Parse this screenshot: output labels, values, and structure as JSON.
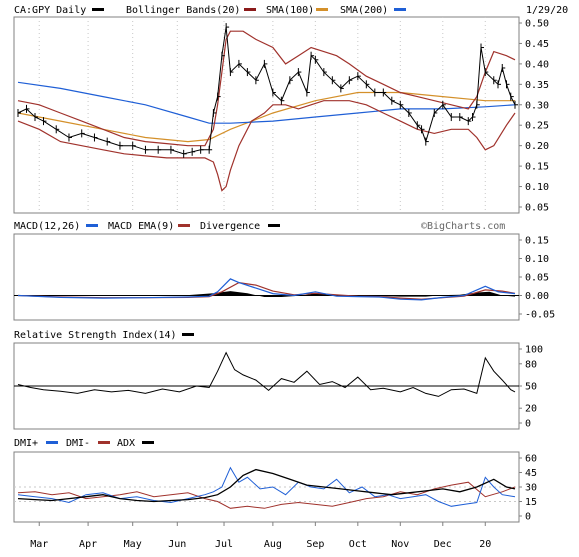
{
  "header": {
    "symbol_label": "CA:GPY Daily",
    "date": "1/29/20"
  },
  "legends": {
    "price": [
      {
        "label": "CA:GPY Daily",
        "color": "#000000"
      },
      {
        "label": "Bollinger Bands(20)",
        "color": "#000000"
      },
      {
        "label": "SMA(100)",
        "color": "#8b1a1a"
      },
      {
        "label": "SMA(200)",
        "color": "#d4902a"
      }
    ],
    "price_extra_swatch": "#1f5fd6",
    "macd": [
      {
        "label": "MACD(12,26)",
        "color": "#1f5fd6"
      },
      {
        "label": "MACD EMA(9)",
        "color": "#a0322c"
      },
      {
        "label": "Divergence",
        "color": "#000000"
      }
    ],
    "rsi": [
      {
        "label": "Relative Strength Index(14)",
        "color": "#000000"
      }
    ],
    "dmi": [
      {
        "label": "DMI+",
        "color": "#1f5fd6"
      },
      {
        "label": "DMI-",
        "color": "#a0322c"
      },
      {
        "label": "ADX",
        "color": "#000000"
      }
    ]
  },
  "watermark": "©BigCharts.com",
  "colors": {
    "price": "#000000",
    "bollinger": "#a0322c",
    "sma100": "#d4902a",
    "sma200": "#1f5fd6",
    "macd": "#1f5fd6",
    "macd_ema": "#a0322c",
    "divergence": "#000000",
    "rsi": "#000000",
    "dmi_plus": "#1f5fd6",
    "dmi_minus": "#a0322c",
    "adx": "#000000",
    "panel_border": "#808080",
    "grid": "#c8c8c8"
  },
  "chart_data": [
    {
      "type": "line",
      "panel": "price",
      "title": "CA:GPY Daily",
      "ylim": [
        0.05,
        0.5
      ],
      "y_ticks": [
        "0.50",
        "0.45",
        "0.40",
        "0.35",
        "0.30",
        "0.25",
        "0.20",
        "0.15",
        "0.10",
        "0.05"
      ],
      "y_tick_values": [
        0.5,
        0.45,
        0.4,
        0.35,
        0.3,
        0.25,
        0.2,
        0.15,
        0.1,
        0.05
      ],
      "x_labels": [
        "Mar",
        "Apr",
        "May",
        "Jun",
        "Jul",
        "Aug",
        "Sep",
        "Oct",
        "Nov",
        "Dec",
        "20"
      ],
      "x_label_t": [
        0.05,
        0.165,
        0.27,
        0.375,
        0.485,
        0.6,
        0.7,
        0.8,
        0.9,
        1.0,
        1.1
      ],
      "t_range": [
        0,
        1.17
      ],
      "series": [
        {
          "name": "CA:GPY Daily",
          "x": [
            0,
            0.02,
            0.04,
            0.06,
            0.09,
            0.12,
            0.15,
            0.18,
            0.21,
            0.24,
            0.27,
            0.3,
            0.33,
            0.36,
            0.39,
            0.41,
            0.43,
            0.45,
            0.46,
            0.47,
            0.48,
            0.49,
            0.5,
            0.52,
            0.54,
            0.56,
            0.58,
            0.6,
            0.62,
            0.64,
            0.66,
            0.68,
            0.69,
            0.7,
            0.72,
            0.74,
            0.76,
            0.78,
            0.8,
            0.82,
            0.84,
            0.86,
            0.88,
            0.9,
            0.92,
            0.94,
            0.95,
            0.96,
            0.98,
            1.0,
            1.02,
            1.04,
            1.06,
            1.07,
            1.08,
            1.09,
            1.1,
            1.12,
            1.13,
            1.14,
            1.15,
            1.16,
            1.17
          ],
          "y": [
            0.28,
            0.29,
            0.27,
            0.26,
            0.24,
            0.22,
            0.23,
            0.22,
            0.21,
            0.2,
            0.2,
            0.19,
            0.19,
            0.19,
            0.18,
            0.185,
            0.19,
            0.19,
            0.28,
            0.32,
            0.42,
            0.49,
            0.38,
            0.4,
            0.38,
            0.36,
            0.4,
            0.33,
            0.31,
            0.36,
            0.38,
            0.33,
            0.42,
            0.41,
            0.38,
            0.36,
            0.34,
            0.36,
            0.37,
            0.35,
            0.33,
            0.33,
            0.31,
            0.3,
            0.28,
            0.25,
            0.24,
            0.21,
            0.28,
            0.3,
            0.27,
            0.27,
            0.26,
            0.27,
            0.3,
            0.44,
            0.38,
            0.36,
            0.35,
            0.39,
            0.35,
            0.32,
            0.3
          ]
        },
        {
          "name": "Bollinger Bands(20) upper",
          "x": [
            0,
            0.05,
            0.1,
            0.15,
            0.2,
            0.25,
            0.3,
            0.35,
            0.4,
            0.44,
            0.46,
            0.47,
            0.48,
            0.49,
            0.5,
            0.53,
            0.56,
            0.6,
            0.63,
            0.66,
            0.69,
            0.72,
            0.75,
            0.78,
            0.82,
            0.86,
            0.9,
            0.94,
            0.98,
            1.02,
            1.06,
            1.08,
            1.1,
            1.12,
            1.15,
            1.17
          ],
          "y": [
            0.31,
            0.3,
            0.28,
            0.26,
            0.24,
            0.22,
            0.21,
            0.205,
            0.2,
            0.2,
            0.24,
            0.3,
            0.38,
            0.46,
            0.48,
            0.48,
            0.46,
            0.44,
            0.4,
            0.42,
            0.44,
            0.43,
            0.42,
            0.4,
            0.37,
            0.35,
            0.33,
            0.32,
            0.31,
            0.3,
            0.29,
            0.32,
            0.38,
            0.43,
            0.42,
            0.41
          ]
        },
        {
          "name": "Bollinger Bands(20) lower",
          "x": [
            0,
            0.05,
            0.1,
            0.15,
            0.2,
            0.25,
            0.3,
            0.35,
            0.4,
            0.44,
            0.46,
            0.47,
            0.48,
            0.49,
            0.5,
            0.52,
            0.55,
            0.58,
            0.6,
            0.63,
            0.66,
            0.69,
            0.72,
            0.75,
            0.78,
            0.82,
            0.86,
            0.9,
            0.94,
            0.98,
            1.02,
            1.06,
            1.08,
            1.1,
            1.12,
            1.15,
            1.17
          ],
          "y": [
            0.26,
            0.24,
            0.21,
            0.2,
            0.19,
            0.18,
            0.175,
            0.17,
            0.17,
            0.17,
            0.16,
            0.13,
            0.09,
            0.1,
            0.14,
            0.2,
            0.26,
            0.28,
            0.3,
            0.3,
            0.29,
            0.3,
            0.31,
            0.31,
            0.31,
            0.3,
            0.28,
            0.26,
            0.24,
            0.23,
            0.24,
            0.24,
            0.22,
            0.19,
            0.2,
            0.25,
            0.28
          ]
        },
        {
          "name": "SMA(100)",
          "x": [
            0,
            0.1,
            0.2,
            0.3,
            0.4,
            0.45,
            0.5,
            0.6,
            0.7,
            0.8,
            0.9,
            1.0,
            1.1,
            1.17
          ],
          "y": [
            0.28,
            0.26,
            0.24,
            0.22,
            0.21,
            0.215,
            0.24,
            0.28,
            0.31,
            0.33,
            0.33,
            0.32,
            0.31,
            0.31
          ]
        },
        {
          "name": "SMA(200)",
          "x": [
            0,
            0.1,
            0.2,
            0.3,
            0.4,
            0.45,
            0.5,
            0.6,
            0.7,
            0.8,
            0.9,
            1.0,
            1.1,
            1.17
          ],
          "y": [
            0.355,
            0.34,
            0.32,
            0.3,
            0.27,
            0.255,
            0.255,
            0.26,
            0.27,
            0.28,
            0.29,
            0.29,
            0.295,
            0.3
          ]
        }
      ]
    },
    {
      "type": "line",
      "panel": "macd",
      "title": "MACD(12,26)",
      "ylim": [
        -0.05,
        0.15
      ],
      "y_ticks": [
        "0.15",
        "0.10",
        "0.05",
        "0.00",
        "-0.05"
      ],
      "y_tick_values": [
        0.15,
        0.1,
        0.05,
        0.0,
        -0.05
      ],
      "series": [
        {
          "name": "MACD(12,26)",
          "x": [
            0,
            0.1,
            0.2,
            0.3,
            0.4,
            0.45,
            0.47,
            0.5,
            0.52,
            0.56,
            0.6,
            0.65,
            0.7,
            0.75,
            0.8,
            0.85,
            0.9,
            0.95,
            1.0,
            1.05,
            1.1,
            1.13,
            1.17
          ],
          "y": [
            0.0,
            -0.005,
            -0.007,
            -0.006,
            -0.004,
            -0.002,
            0.01,
            0.045,
            0.035,
            0.02,
            0.005,
            0.0,
            0.01,
            -0.002,
            -0.003,
            -0.004,
            -0.01,
            -0.012,
            -0.005,
            0.0,
            0.025,
            0.01,
            0.005
          ]
        },
        {
          "name": "MACD EMA(9)",
          "x": [
            0,
            0.1,
            0.2,
            0.3,
            0.4,
            0.45,
            0.48,
            0.52,
            0.56,
            0.6,
            0.65,
            0.7,
            0.75,
            0.8,
            0.85,
            0.9,
            0.95,
            1.0,
            1.05,
            1.1,
            1.14,
            1.17
          ],
          "y": [
            0.0,
            -0.004,
            -0.006,
            -0.006,
            -0.005,
            -0.003,
            0.01,
            0.035,
            0.028,
            0.012,
            0.002,
            0.006,
            0.002,
            -0.002,
            -0.003,
            -0.007,
            -0.01,
            -0.006,
            -0.002,
            0.015,
            0.012,
            0.006
          ]
        },
        {
          "name": "Divergence",
          "x": [
            0,
            0.1,
            0.2,
            0.3,
            0.4,
            0.46,
            0.5,
            0.54,
            0.58,
            0.62,
            0.67,
            0.7,
            0.73,
            0.78,
            0.84,
            0.9,
            0.96,
            1.0,
            1.04,
            1.08,
            1.11,
            1.14,
            1.17
          ],
          "y": [
            0.0,
            -0.001,
            -0.001,
            0.0,
            0.001,
            0.006,
            0.012,
            0.006,
            -0.004,
            -0.004,
            0.0,
            0.006,
            0.002,
            -0.001,
            -0.001,
            -0.003,
            -0.003,
            0.001,
            0.002,
            0.008,
            0.01,
            0.0,
            -0.003
          ]
        }
      ]
    },
    {
      "type": "line",
      "panel": "rsi",
      "title": "Relative Strength Index(14)",
      "ylim": [
        0,
        100
      ],
      "y_ticks": [
        "100",
        "80",
        "50",
        "20",
        "0"
      ],
      "y_tick_values": [
        100,
        80,
        50,
        20,
        0
      ],
      "series": [
        {
          "name": "Relative Strength Index(14)",
          "x": [
            0,
            0.03,
            0.06,
            0.1,
            0.14,
            0.18,
            0.22,
            0.26,
            0.3,
            0.34,
            0.38,
            0.42,
            0.45,
            0.47,
            0.49,
            0.51,
            0.53,
            0.56,
            0.59,
            0.62,
            0.65,
            0.68,
            0.71,
            0.74,
            0.77,
            0.8,
            0.83,
            0.86,
            0.9,
            0.93,
            0.96,
            0.99,
            1.02,
            1.05,
            1.08,
            1.1,
            1.12,
            1.14,
            1.16,
            1.17
          ],
          "y": [
            52,
            48,
            45,
            43,
            40,
            45,
            42,
            44,
            40,
            46,
            42,
            50,
            48,
            70,
            95,
            72,
            65,
            58,
            44,
            60,
            55,
            70,
            52,
            56,
            48,
            62,
            45,
            47,
            42,
            48,
            40,
            36,
            45,
            46,
            40,
            88,
            70,
            58,
            45,
            42
          ]
        }
      ]
    },
    {
      "type": "line",
      "panel": "dmi",
      "title": "DMI+",
      "ylim": [
        0,
        60
      ],
      "y_ticks": [
        "60",
        "45",
        "30",
        "15",
        "0"
      ],
      "y_tick_values": [
        60,
        45,
        30,
        15,
        0
      ],
      "series": [
        {
          "name": "DMI+",
          "x": [
            0,
            0.04,
            0.08,
            0.12,
            0.16,
            0.2,
            0.24,
            0.28,
            0.32,
            0.36,
            0.4,
            0.44,
            0.46,
            0.48,
            0.5,
            0.52,
            0.54,
            0.57,
            0.6,
            0.63,
            0.66,
            0.69,
            0.72,
            0.75,
            0.78,
            0.81,
            0.84,
            0.87,
            0.9,
            0.93,
            0.96,
            0.99,
            1.02,
            1.05,
            1.08,
            1.1,
            1.12,
            1.14,
            1.17
          ],
          "y": [
            22,
            20,
            18,
            14,
            22,
            24,
            18,
            20,
            16,
            14,
            18,
            22,
            25,
            30,
            50,
            35,
            40,
            28,
            30,
            22,
            35,
            30,
            28,
            38,
            24,
            30,
            20,
            22,
            18,
            20,
            22,
            15,
            10,
            12,
            14,
            40,
            30,
            22,
            20
          ]
        },
        {
          "name": "DMI-",
          "x": [
            0,
            0.04,
            0.08,
            0.12,
            0.16,
            0.2,
            0.24,
            0.28,
            0.32,
            0.36,
            0.4,
            0.44,
            0.47,
            0.5,
            0.54,
            0.58,
            0.62,
            0.66,
            0.7,
            0.74,
            0.78,
            0.82,
            0.86,
            0.9,
            0.94,
            0.98,
            1.02,
            1.06,
            1.1,
            1.14,
            1.17
          ],
          "y": [
            24,
            25,
            22,
            24,
            18,
            20,
            22,
            25,
            20,
            22,
            24,
            18,
            15,
            8,
            10,
            8,
            12,
            14,
            12,
            10,
            14,
            18,
            20,
            25,
            22,
            28,
            32,
            35,
            20,
            25,
            30
          ]
        },
        {
          "name": "ADX",
          "x": [
            0,
            0.04,
            0.08,
            0.12,
            0.16,
            0.2,
            0.24,
            0.28,
            0.32,
            0.36,
            0.4,
            0.44,
            0.47,
            0.5,
            0.53,
            0.56,
            0.6,
            0.64,
            0.68,
            0.72,
            0.76,
            0.8,
            0.84,
            0.88,
            0.92,
            0.96,
            1.0,
            1.04,
            1.08,
            1.12,
            1.15,
            1.17
          ],
          "y": [
            18,
            17,
            16,
            18,
            20,
            22,
            18,
            16,
            15,
            16,
            17,
            19,
            22,
            30,
            42,
            48,
            44,
            38,
            32,
            30,
            28,
            26,
            24,
            22,
            24,
            26,
            28,
            25,
            30,
            38,
            30,
            28
          ]
        }
      ]
    }
  ]
}
